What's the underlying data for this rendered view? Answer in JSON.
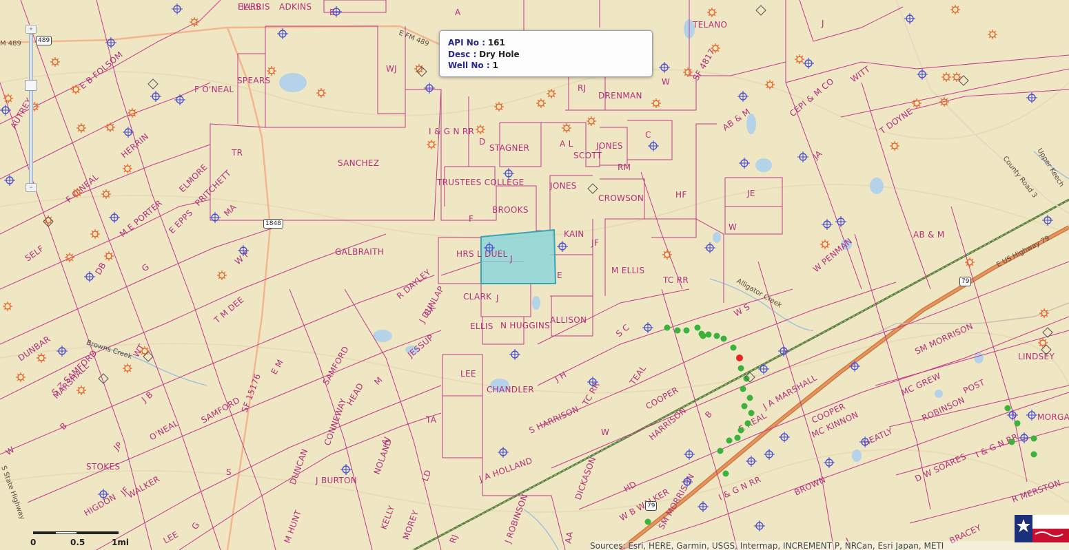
{
  "popup": {
    "api_key": "API No :",
    "api_val": "161",
    "desc_key": "Desc :",
    "desc_val": "Dry Hole",
    "well_key": "Well No :",
    "well_val": "1"
  },
  "survey_labels": [
    "HARRIS",
    "ADKINS",
    "E",
    "A",
    "TELANO",
    "J",
    "WJ",
    "SPEARS",
    "F O'NEAL",
    "E B FOLSOM",
    "AUTREY",
    "RJ",
    "DRENMAN",
    "W",
    "SF 4817",
    "AB & M",
    "CEPI & M CO",
    "WITT",
    "T DOYNE",
    "I & G N RR",
    "D",
    "STAGNER",
    "A L",
    "JONES",
    "SCOTT",
    "C",
    "TR",
    "SANCHEZ",
    "HERRIN",
    "ELMORE",
    "TRUSTEES COLLEGE",
    "RM",
    "JONES",
    "CROWSON",
    "HF",
    "JE",
    "JA",
    "F O'NEAL",
    "W",
    "BROOKS",
    "F",
    "KAIN",
    "JF",
    "PRITCHETT",
    "MA",
    "E EPPS",
    "SELF",
    "M E PORTER",
    "G",
    "W F",
    "GALBRAITH",
    "HRS L DUEL",
    "J",
    "E",
    "M ELLIS",
    "TC RR",
    "W PENMAN",
    "AB & M",
    "DB",
    "T M DEE",
    "R DAYLEY",
    "CLARK",
    "J",
    "W S",
    "ALLISON",
    "DUNBAR",
    "S Z SAMFORD",
    "J DUNLAP",
    "ELLIS",
    "N HUGGINS",
    "S C",
    "WT",
    "E M",
    "J B",
    "SAMFORD",
    "JESSUP",
    "M",
    "LEE",
    "J H",
    "TEAL",
    "COOPER",
    "SM MORRISON",
    "CHANDLER",
    "TC RR",
    "MARSHALL",
    "HEAD",
    "TA",
    "S HARRISON",
    "J A MARSHALL",
    "MC GREW",
    "POST",
    "LINDSEY",
    "B",
    "JP",
    "SF 15176",
    "O'NEAL",
    "SAMFORD",
    "AJ",
    "CONNEWAY",
    "LD",
    "NOLAND",
    "HARRISON",
    "E REAL",
    "MC KINNON",
    "COOPER",
    "ROBINSON",
    "HEATLY",
    "I & G N RR",
    "MORGAN",
    "W",
    "STOKES",
    "S",
    "JF",
    "DUNCAN",
    "J BURTON",
    "B",
    "W",
    "HD",
    "DICKASON",
    "I & G N RR",
    "BROWN",
    "D W SOARES",
    "HIGDON",
    "WALKER",
    "G",
    "M HUNT",
    "KELLY",
    "J A HOLLAND",
    "J ROBINSON",
    "W B WALKER",
    "SM MORRISON",
    "J",
    "BRACEY",
    "R MERSTON",
    "MOREY",
    "RJ",
    "AA",
    "LEE",
    "GK",
    "ELLIS"
  ],
  "road_labels": [
    "M 489",
    "489",
    "E FM 489",
    "1848",
    "E US Highway 79",
    "79",
    "Alligator Creek",
    "Browns Creek",
    "County Road 3",
    "Upper Keech",
    "S State Highway",
    "79"
  ],
  "scale": {
    "zero": "0",
    "half": "0.5",
    "one": "1mi"
  },
  "attribution": "Sources: Esri, HERE, Garmin, USGS, Intermap, INCREMENT P, NRCan, Esri Japan, METI",
  "zoom": {
    "plus": "+",
    "minus": "−"
  },
  "colors": {
    "land": "#efe6c4",
    "survey_line": "#c23a8c",
    "survey_text": "#b0307a",
    "water": "#b5d3e8",
    "highway": "#d8804f",
    "railroad": "#4e7a3a",
    "well_oil": "#e8692b",
    "well_dry": "#4b4fd0",
    "well_green": "#3bb23b",
    "well_red": "#e8241f",
    "selected_fill": "#7fd3dc"
  },
  "selected_tract_label": "E"
}
